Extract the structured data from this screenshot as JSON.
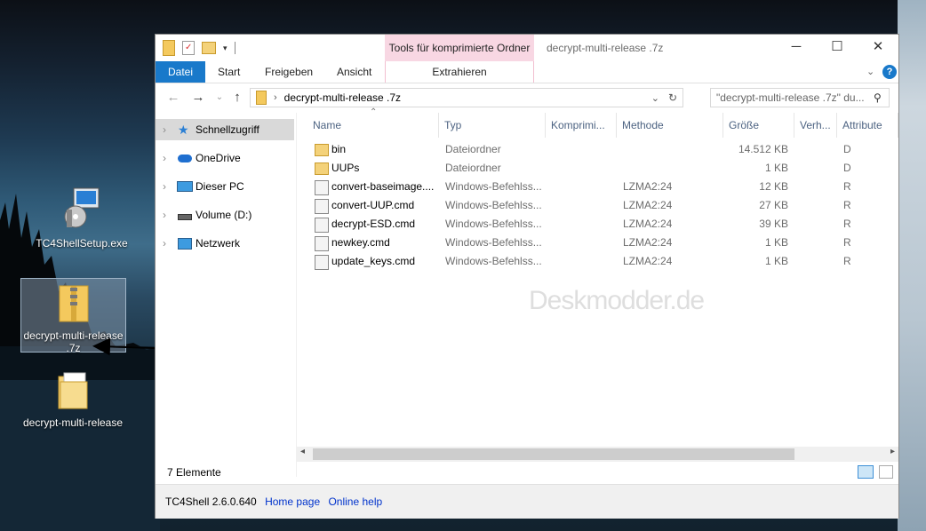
{
  "desktop": {
    "icons": [
      {
        "label": "TC4ShellSetup.exe"
      },
      {
        "label": "decrypt-multi-release .7z"
      },
      {
        "label": "decrypt-multi-release"
      }
    ]
  },
  "window": {
    "context_tab_group": "Tools für komprimierte Ordner",
    "title": "decrypt-multi-release .7z",
    "ribbon_tabs": [
      "Datei",
      "Start",
      "Freigeben",
      "Ansicht",
      "Extrahieren"
    ],
    "address": {
      "path": "decrypt-multi-release .7z"
    },
    "search": {
      "placeholder": "\"decrypt-multi-release .7z\" du..."
    },
    "nav_pane": [
      {
        "label": "Schnellzugriff",
        "icon": "star-icon",
        "selected": true
      },
      {
        "label": "OneDrive",
        "icon": "cloud-icon"
      },
      {
        "label": "Dieser PC",
        "icon": "computer-icon"
      },
      {
        "label": "Volume (D:)",
        "icon": "drive-icon"
      },
      {
        "label": "Netzwerk",
        "icon": "network-icon"
      }
    ],
    "columns": [
      "Name",
      "Typ",
      "Komprimi...",
      "Methode",
      "Größe",
      "Verh...",
      "Attribute"
    ],
    "files": [
      {
        "name": "bin",
        "type": "Dateiordner",
        "compressed": "",
        "method": "",
        "size": "14.512 KB",
        "attr": "D",
        "icon": "folder-icon"
      },
      {
        "name": "UUPs",
        "type": "Dateiordner",
        "compressed": "",
        "method": "",
        "size": "1 KB",
        "attr": "D",
        "icon": "folder-icon"
      },
      {
        "name": "convert-baseimage....",
        "type": "Windows-Befehlss...",
        "compressed": "",
        "method": "LZMA2:24",
        "size": "12 KB",
        "attr": "R",
        "icon": "cmd-file-icon"
      },
      {
        "name": "convert-UUP.cmd",
        "type": "Windows-Befehlss...",
        "compressed": "",
        "method": "LZMA2:24",
        "size": "27 KB",
        "attr": "R",
        "icon": "cmd-file-icon"
      },
      {
        "name": "decrypt-ESD.cmd",
        "type": "Windows-Befehlss...",
        "compressed": "",
        "method": "LZMA2:24",
        "size": "39 KB",
        "attr": "R",
        "icon": "cmd-file-icon"
      },
      {
        "name": "newkey.cmd",
        "type": "Windows-Befehlss...",
        "compressed": "",
        "method": "LZMA2:24",
        "size": "1 KB",
        "attr": "R",
        "icon": "cmd-file-icon"
      },
      {
        "name": "update_keys.cmd",
        "type": "Windows-Befehlss...",
        "compressed": "",
        "method": "LZMA2:24",
        "size": "1 KB",
        "attr": "R",
        "icon": "cmd-file-icon"
      }
    ],
    "status": "7 Elemente",
    "footer": {
      "version": "TC4Shell 2.6.0.640",
      "home_link": "Home page",
      "help_link": "Online help"
    },
    "watermark": "Deskmodder.de"
  }
}
